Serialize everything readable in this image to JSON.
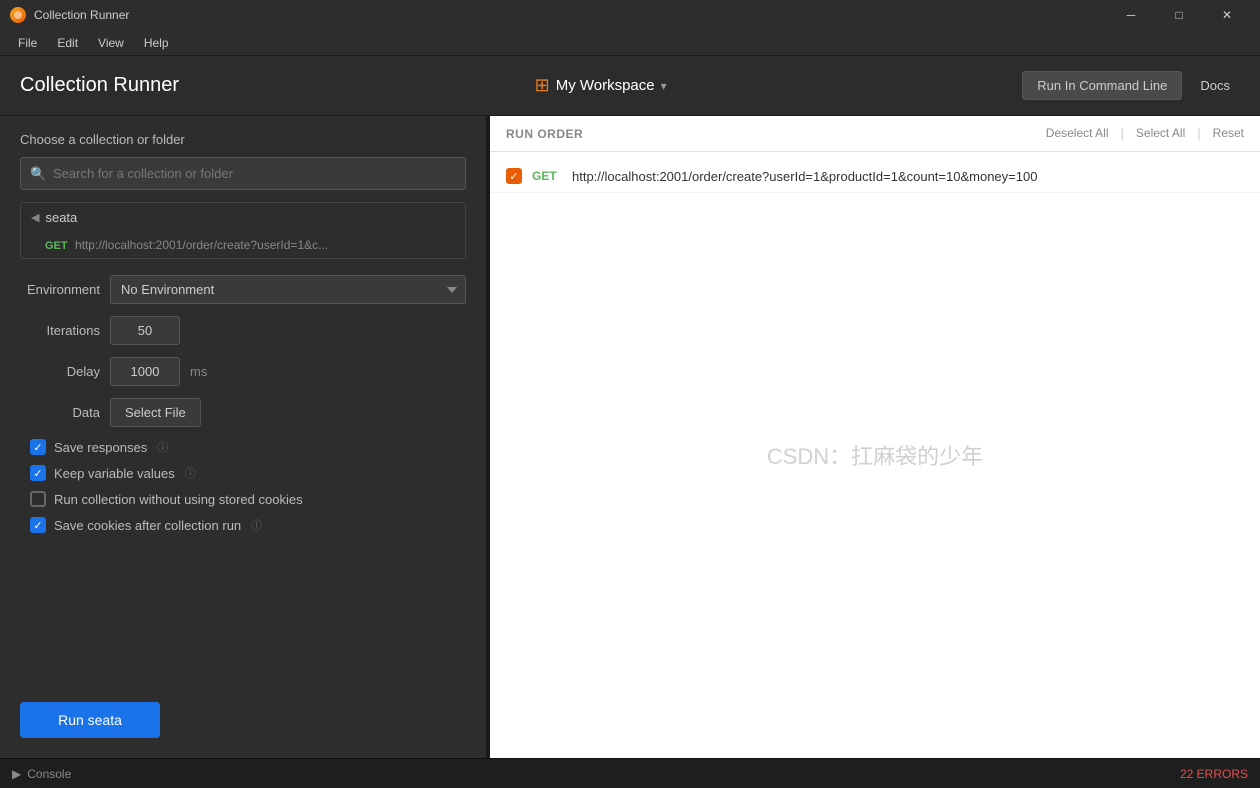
{
  "titlebar": {
    "title": "Collection Runner",
    "icon": "postman-icon",
    "minimize": "─",
    "maximize": "□",
    "close": "✕"
  },
  "menubar": {
    "items": [
      "File",
      "Edit",
      "View",
      "Help"
    ]
  },
  "header": {
    "title": "Collection Runner",
    "workspace": {
      "icon": "⊞",
      "label": "My Workspace",
      "chevron": "▾"
    },
    "run_cmd_label": "Run In Command Line",
    "docs_label": "Docs"
  },
  "left": {
    "choose_label": "Choose a collection or folder",
    "search_placeholder": "Search for a collection or folder",
    "collection_name": "seata",
    "sub_item": {
      "method": "GET",
      "url": "http://localhost:2001/order/create?userId=1&c..."
    },
    "form": {
      "environment_label": "Environment",
      "environment_value": "No Environment",
      "environment_options": [
        "No Environment"
      ],
      "iterations_label": "Iterations",
      "iterations_value": "50",
      "delay_label": "Delay",
      "delay_value": "1000",
      "delay_unit": "ms",
      "data_label": "Data",
      "select_file_label": "Select File"
    },
    "checkboxes": [
      {
        "id": "save-responses",
        "checked": true,
        "label": "Save responses",
        "info": true
      },
      {
        "id": "keep-variable",
        "checked": true,
        "label": "Keep variable values",
        "info": true
      },
      {
        "id": "run-no-cookies",
        "checked": false,
        "label": "Run collection without using stored cookies",
        "info": false
      },
      {
        "id": "save-cookies",
        "checked": true,
        "label": "Save cookies after collection run",
        "info": true
      }
    ],
    "run_btn_label": "Run seata"
  },
  "right": {
    "run_order_title": "RUN ORDER",
    "deselect_all": "Deselect All",
    "select_all": "Select All",
    "reset": "Reset",
    "items": [
      {
        "checked": true,
        "method": "GET",
        "url": "http://localhost:2001/order/create?userId=1&productId=1&count=10&money=100"
      }
    ],
    "watermark": "CSDN：扛麻袋的少年"
  },
  "statusbar": {
    "console_icon": "▶",
    "console_label": "Console",
    "errors": "22 ERRORS"
  }
}
